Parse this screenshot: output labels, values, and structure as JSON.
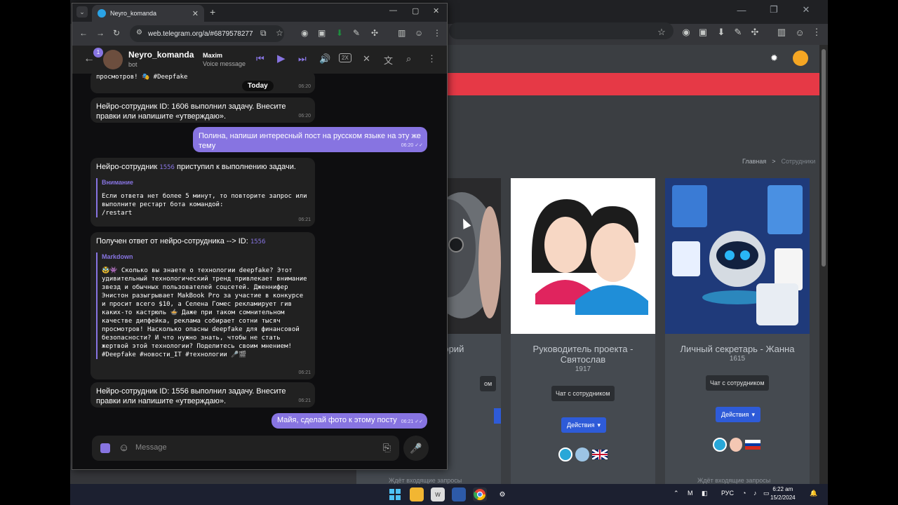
{
  "background_window": {
    "controls": [
      "—",
      "❐",
      "✕"
    ],
    "breadcrumb": {
      "home": "Главная",
      "separator": ">",
      "current": "Сотрудники"
    },
    "cards": [
      {
        "title": "игорий",
        "number": "",
        "chat_label": "ом"
      },
      {
        "title": "Руководитель проекта - Святослав",
        "number": "1917",
        "chat_label": "Чат с сотрудником",
        "actions_label": "Действия"
      },
      {
        "title": "Личный секретарь - Жанна",
        "number": "1615",
        "chat_label": "Чат с сотрудником",
        "actions_label": "Действия"
      }
    ],
    "footer_hint": "Ждёт входящие запросы"
  },
  "telegram_browser": {
    "tab_title": "Neyro_komanda",
    "url": "web.telegram.org/a/#6879578277",
    "header": {
      "unread_count": "1",
      "chat_name": "Neyro_komanda",
      "chat_status": "bot",
      "player_name": "Maxim",
      "player_type": "Voice message",
      "speed_label": "2X"
    },
    "messages": [
      {
        "text": "просмотров! 🎭 #Deepfake",
        "time": "06:20"
      },
      {
        "date_label": "Today"
      },
      {
        "text": "Нейро-сотрудник ID: 1606 выполнил задачу. Внесите правки или напишите «утверждаю».",
        "time": "06:20"
      },
      {
        "text": "Полина, напиши интересный пост на русском языке на эту же тему",
        "time": "06:20"
      },
      {
        "text_before": "Нейро-сотрудник ",
        "code": "1556",
        "text_after": " приступил к выполнению задачи.",
        "quote_title": "Внимание",
        "quote_body": "Если ответа нет более 5 минут, то повторите запрос или выполните рестарт бота командой:\n/restart",
        "time": "06:21"
      },
      {
        "text_before": "Получен ответ от нейро-сотрудника --> ID: ",
        "code": "1556",
        "quote_title": "Markdown",
        "quote_body": "🥸👾 Сколько вы знаете о технологии deepfake? Этот удивительный технологический тренд привлекает внимание звезд и обычных пользователей соцсетей. Дженнифер Энистон разыгрывает MakBook Pro за участие в конкурсе и просит всего $10, а Селена Гомес рекламирует гив каких-то кастрюль 🍲 Даже при таком сомнительном качестве дипфейка, реклама собирает сотни тысяч просмотров! Насколько опасны deepfake для финансовой безопасности? И что нужно знать, чтобы не стать жертвой этой технологии? Поделитесь своим мнением! #Deepfake #новости_IT #технологии 🎤🎬",
        "time": "06:21"
      },
      {
        "text": "Нейро-сотрудник ID: 1556 выполнил задачу. Внесите правки или напишите «утверждаю».",
        "time": "06:21"
      },
      {
        "text": "Майя, сделай фото к этому посту",
        "time": "06:21"
      }
    ],
    "input_placeholder": "Message"
  },
  "taskbar": {
    "lang": "РУС",
    "time": "6:22 am",
    "date": "15/2/2024"
  }
}
